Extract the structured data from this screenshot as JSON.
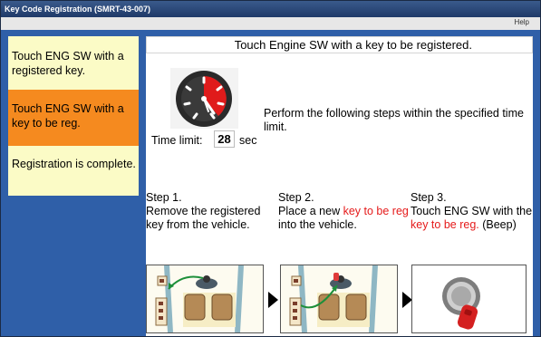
{
  "window": {
    "title": "Key Code Registration (SMRT-43-007)"
  },
  "menu": {
    "help": "Help"
  },
  "sidebar": {
    "items": [
      {
        "label": "Touch ENG SW with a registered key.",
        "state": "inactive"
      },
      {
        "label": "Touch ENG SW with a key to be reg.",
        "state": "active"
      },
      {
        "label": "Registration is complete.",
        "state": "inactive"
      }
    ]
  },
  "main": {
    "instruction": "Touch Engine SW with a key to be registered.",
    "timer": {
      "label": "Time limit:",
      "value": "28",
      "unit": "sec",
      "icon": "timer-dial-icon"
    },
    "perform_text": "Perform the following steps within the specified time limit.",
    "steps": [
      {
        "title": "Step 1.",
        "text": "Remove the registered key from the vehicle."
      },
      {
        "title": "Step 2.",
        "text_before": "Place a new ",
        "highlight": "key to be reg",
        "text_after": " into the vehicle."
      },
      {
        "title": "Step 3.",
        "text_before": "Touch ENG SW with the ",
        "highlight": "key to be reg.",
        "text_after": " (Beep)"
      }
    ]
  },
  "colors": {
    "titlebar": "#1f3a68",
    "panel_background": "#2f5fa8",
    "sidebar_inactive": "#fbfbc6",
    "sidebar_active": "#f58a1f",
    "highlight_text": "#e51a1a"
  }
}
